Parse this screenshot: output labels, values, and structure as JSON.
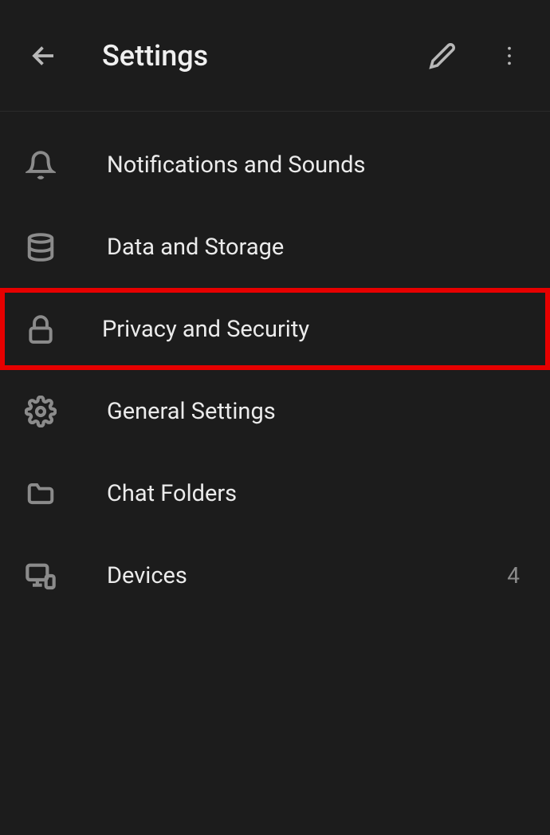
{
  "header": {
    "title": "Settings"
  },
  "items": [
    {
      "label": "Notifications and Sounds",
      "icon": "bell-icon",
      "value": null
    },
    {
      "label": "Data and Storage",
      "icon": "database-icon",
      "value": null
    },
    {
      "label": "Privacy and Security",
      "icon": "lock-icon",
      "value": null
    },
    {
      "label": "General Settings",
      "icon": "gear-icon",
      "value": null
    },
    {
      "label": "Chat Folders",
      "icon": "folder-icon",
      "value": null
    },
    {
      "label": "Devices",
      "icon": "devices-icon",
      "value": "4"
    }
  ],
  "highlighted_index": 2
}
